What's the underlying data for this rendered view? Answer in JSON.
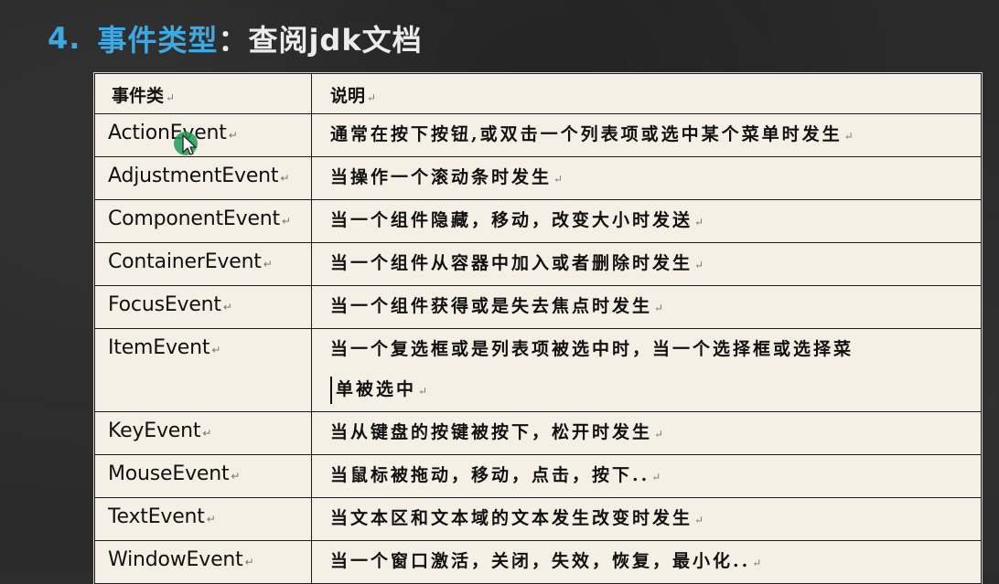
{
  "title": {
    "number": "4.",
    "main": "事件类型",
    "colon": "：",
    "sub": "查阅jdk文档"
  },
  "table": {
    "headers": [
      "事件类",
      "说明"
    ],
    "rows": [
      {
        "event": "ActionEvent",
        "desc": "通常在按下按钮,或双击一个列表项或选中某个菜单时发生"
      },
      {
        "event": "AdjustmentEvent",
        "desc": "当操作一个滚动条时发生"
      },
      {
        "event": "ComponentEvent",
        "desc": "当一个组件隐藏，移动，改变大小时发送"
      },
      {
        "event": "ContainerEvent",
        "desc": "当一个组件从容器中加入或者删除时发生"
      },
      {
        "event": "FocusEvent",
        "desc": "当一个组件获得或是失去焦点时发生"
      },
      {
        "event": "ItemEvent",
        "desc": "当一个复选框或是列表项被选中时，当一个选择框或选择菜",
        "desc2": "单被选中"
      },
      {
        "event": "KeyEvent",
        "desc": "当从键盘的按键被按下，松开时发生"
      },
      {
        "event": "MouseEvent",
        "desc": "当鼠标被拖动，移动，点击，按下.."
      },
      {
        "event": "TextEvent",
        "desc": "当文本区和文本域的文本发生改变时发生"
      },
      {
        "event": "WindowEvent",
        "desc": "当一个窗口激活，关闭，失效，恢复，最小化.."
      }
    ]
  },
  "paragraph_mark": "↵",
  "colors": {
    "title_accent": "#3fa8e0",
    "title_text": "#ececec",
    "background": "#2b2b2b",
    "table_bg": "#f6efe6",
    "cursor_highlight": "#1e9e55"
  },
  "icons": {
    "pointer": "mouse-pointer-icon"
  }
}
